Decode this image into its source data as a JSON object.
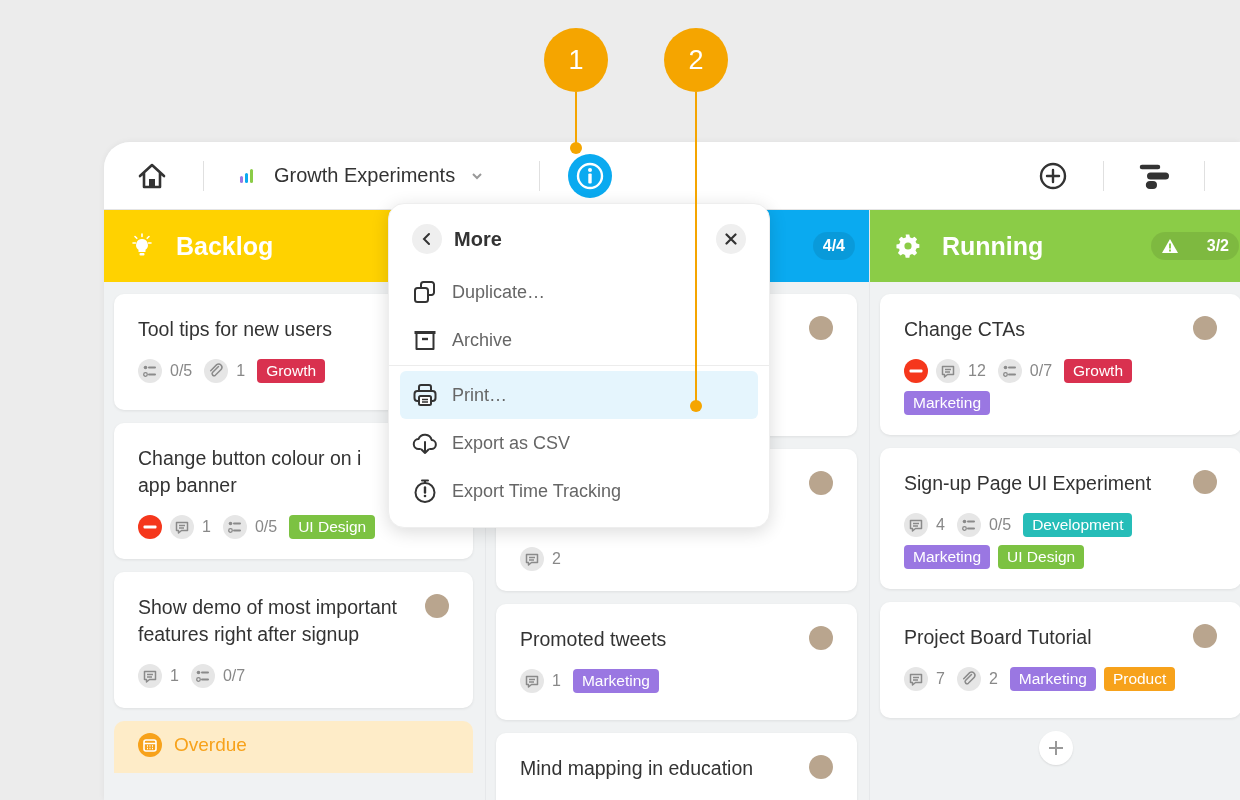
{
  "toolbar": {
    "project_title": "Growth Experiments"
  },
  "columns": [
    {
      "title": "Backlog",
      "color": "#ffd200",
      "cards": [
        {
          "title": "Tool tips for new users",
          "meta": [
            {
              "kind": "checklist",
              "text": "0/5"
            },
            {
              "kind": "attachment",
              "text": "1"
            }
          ],
          "tags": [
            {
              "label": "Growth",
              "color": "#d9314f"
            }
          ]
        },
        {
          "title": "Change button colour on i\napp banner",
          "blocked": true,
          "meta": [
            {
              "kind": "comment",
              "text": "1"
            },
            {
              "kind": "checklist",
              "text": "0/5"
            }
          ],
          "tags": [
            {
              "label": "UI Design",
              "color": "#7cc242"
            }
          ]
        },
        {
          "title": "Show demo of most important features right after signup",
          "avatar": true,
          "meta": [
            {
              "kind": "comment",
              "text": "1"
            },
            {
              "kind": "checklist",
              "text": "0/7"
            }
          ]
        }
      ],
      "footer": {
        "kind": "overdue",
        "label": "Overdue"
      }
    },
    {
      "color": "#0aaaf0",
      "count": "4/4",
      "cards": [
        {
          "avatar": true
        },
        {
          "avatar": true,
          "meta": [
            {
              "kind": "comment",
              "text": "2"
            }
          ]
        },
        {
          "title": "Promoted tweets",
          "avatar": true,
          "meta": [
            {
              "kind": "comment",
              "text": "1"
            }
          ],
          "tags": [
            {
              "label": "Marketing",
              "color": "#9a77e2"
            }
          ]
        },
        {
          "title": "Mind mapping in education",
          "avatar": true
        }
      ]
    },
    {
      "title": "Running",
      "color": "#8bcc47",
      "count": "3/2",
      "warning": true,
      "cards": [
        {
          "title": "Change CTAs",
          "avatar": true,
          "blocked": true,
          "meta": [
            {
              "kind": "comment",
              "text": "12"
            },
            {
              "kind": "checklist",
              "text": "0/7"
            }
          ],
          "tags": [
            {
              "label": "Growth",
              "color": "#d9314f"
            },
            {
              "label": "Marketing",
              "color": "#9a77e2"
            }
          ]
        },
        {
          "title": "Sign-up Page UI Experiment",
          "avatar": true,
          "meta": [
            {
              "kind": "comment",
              "text": "4"
            },
            {
              "kind": "checklist",
              "text": "0/5"
            }
          ],
          "tags": [
            {
              "label": "Development",
              "color": "#26bdb8"
            },
            {
              "label": "Marketing",
              "color": "#9a77e2"
            },
            {
              "label": "UI Design",
              "color": "#7cc242"
            }
          ]
        },
        {
          "title": "Project Board Tutorial",
          "avatar": true,
          "meta": [
            {
              "kind": "comment",
              "text": "7"
            },
            {
              "kind": "attachment",
              "text": "2"
            }
          ],
          "tags": [
            {
              "label": "Marketing",
              "color": "#9a77e2"
            },
            {
              "label": "Product",
              "color": "#f7a21b"
            }
          ]
        }
      ],
      "add_button": true
    }
  ],
  "menu": {
    "title": "More",
    "items": [
      {
        "label": "Duplicate…",
        "selected": false
      },
      {
        "label": "Archive",
        "selected": false
      },
      {
        "label": "Print…",
        "selected": true,
        "separator_before": true
      },
      {
        "label": "Export as CSV",
        "selected": false
      },
      {
        "label": "Export Time Tracking",
        "selected": false
      }
    ]
  },
  "callouts": [
    {
      "label": "1"
    },
    {
      "label": "2"
    }
  ]
}
